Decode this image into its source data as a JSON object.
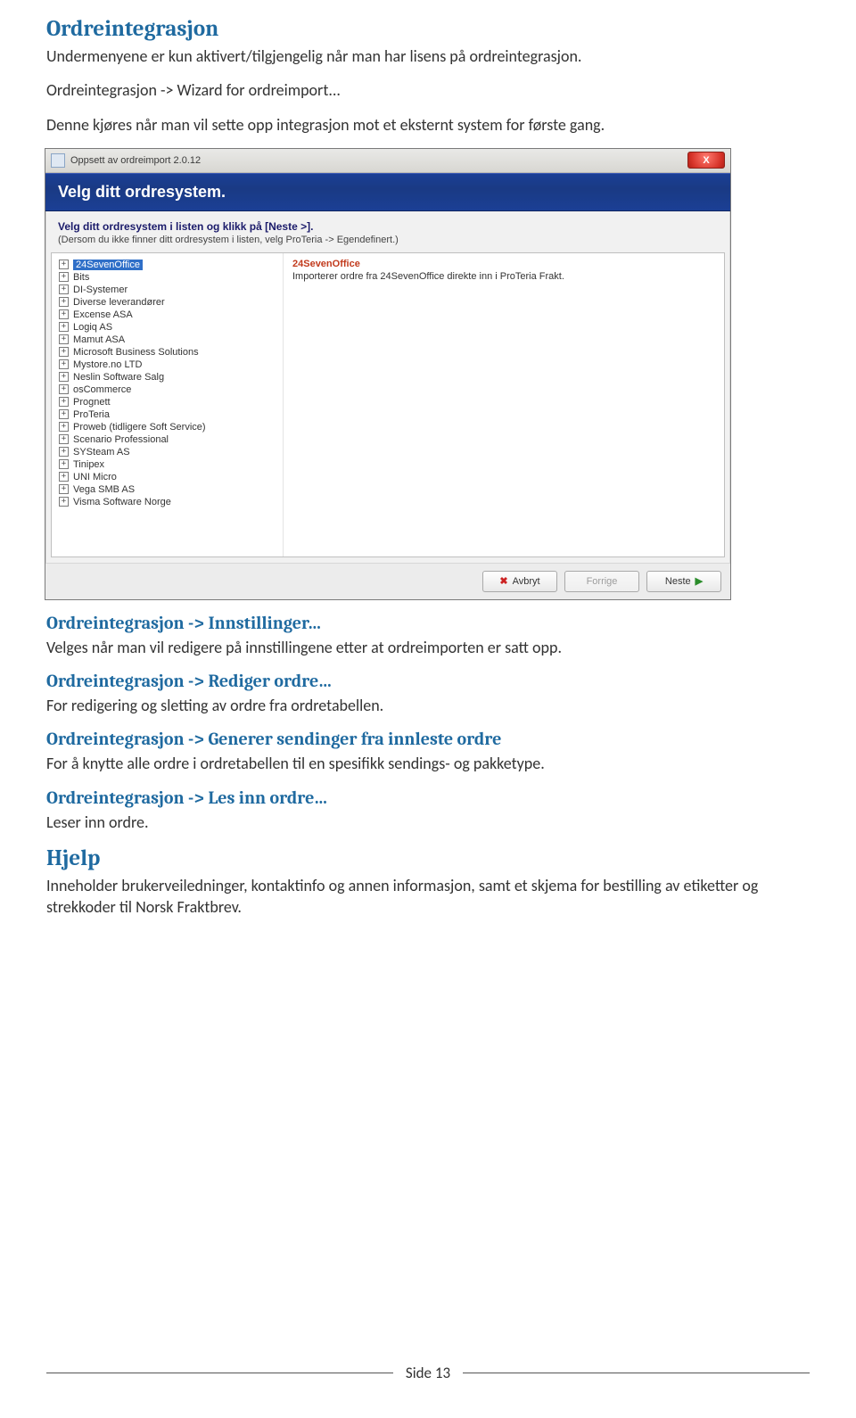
{
  "sections": {
    "s1_title": "Ordreintegrasjon",
    "s1_p1": "Undermenyene er kun aktivert/tilgjengelig når man har lisens på ordreintegrasjon.",
    "s1_p2": "Ordreintegrasjon -> Wizard for ordreimport...",
    "s1_p3": "Denne kjøres når man vil sette opp integrasjon mot et eksternt system for første gang.",
    "s2_title": "Ordreintegrasjon -> Innstillinger…",
    "s2_p1": "Velges når man vil redigere på innstillingene etter at ordreimporten er satt opp.",
    "s3_title": "Ordreintegrasjon -> Rediger ordre…",
    "s3_p1": "For redigering og sletting av ordre fra ordretabellen.",
    "s4_title": "Ordreintegrasjon -> Generer sendinger fra innleste ordre",
    "s4_p1": "For å knytte alle ordre i ordretabellen til en spesifikk sendings- og pakketype.",
    "s5_title": "Ordreintegrasjon -> Les inn ordre…",
    "s5_p1": "Leser inn ordre.",
    "s6_title": "Hjelp",
    "s6_p1": "Inneholder brukerveiledninger, kontaktinfo og annen informasjon, samt et skjema for bestilling av etiketter og strekkoder til Norsk Fraktbrev."
  },
  "wizard": {
    "window_title": "Oppsett av ordreimport 2.0.12",
    "close_label": "X",
    "banner": "Velg ditt ordresystem.",
    "sub_bold": "Velg ditt ordresystem i listen og klikk på [Neste >].",
    "sub_note": "(Dersom du ikke finner ditt ordresystem i listen, velg ProTeria -> Egendefinert.)",
    "selected_name": "24SevenOffice",
    "selected_desc": "Importerer ordre fra 24SevenOffice direkte inn i ProTeria Frakt.",
    "tree_items": [
      "24SevenOffice",
      "Bits",
      "DI-Systemer",
      "Diverse leverandører",
      "Excense ASA",
      "Logiq AS",
      "Mamut ASA",
      "Microsoft Business Solutions",
      "Mystore.no LTD",
      "Neslin Software Salg",
      "osCommerce",
      "Prognett",
      "ProTeria",
      "Proweb (tidligere Soft Service)",
      "Scenario Professional",
      "SYSteam AS",
      "Tinipex",
      "UNI Micro",
      "Vega SMB AS",
      "Visma Software Norge"
    ],
    "buttons": {
      "cancel": "Avbryt",
      "back": "Forrige",
      "next": "Neste"
    }
  },
  "page_number": "Side 13"
}
